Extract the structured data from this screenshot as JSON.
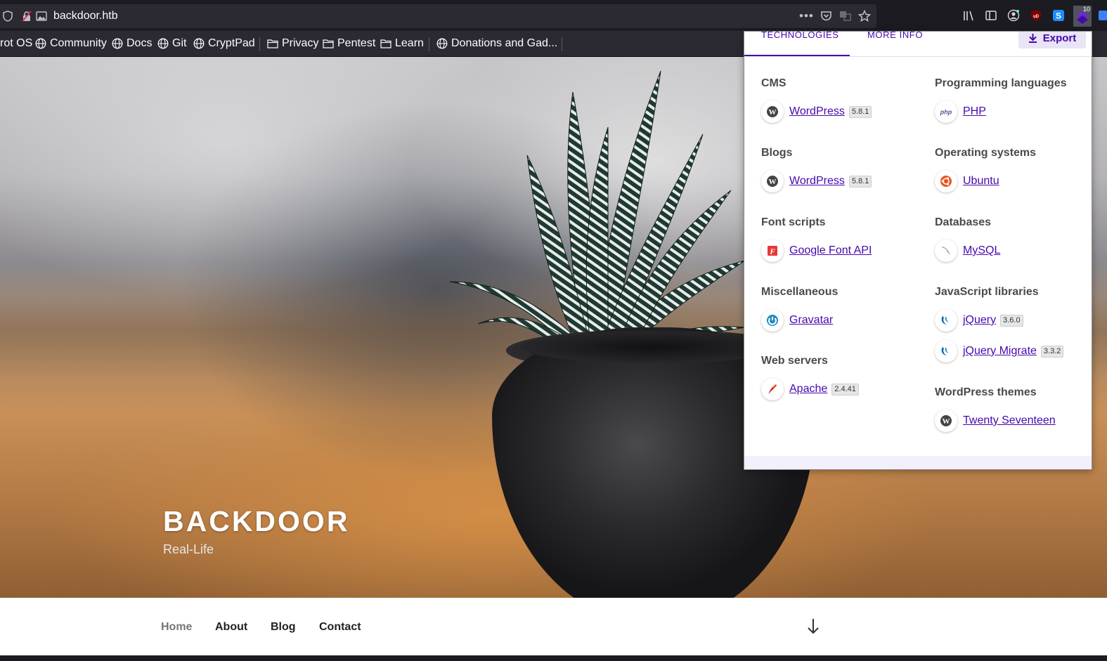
{
  "browser": {
    "url": "backdoor.htb",
    "bookmarks": [
      {
        "label": "rot OS",
        "icon": "globe-icon"
      },
      {
        "label": "Community",
        "icon": "globe-icon"
      },
      {
        "label": "Docs",
        "icon": "globe-icon"
      },
      {
        "label": "Git",
        "icon": "globe-icon"
      },
      {
        "label": "CryptPad",
        "icon": "globe-icon"
      },
      {
        "label": "Privacy",
        "icon": "folder-icon"
      },
      {
        "label": "Pentest",
        "icon": "folder-icon"
      },
      {
        "label": "Learn",
        "icon": "folder-icon"
      },
      {
        "label": "Donations and Gad...",
        "icon": "globe-icon"
      }
    ],
    "extension_badge": "10"
  },
  "site": {
    "title": "BACKDOOR",
    "description": "Real-Life",
    "nav": [
      {
        "label": "Home",
        "current": true
      },
      {
        "label": "About",
        "current": false
      },
      {
        "label": "Blog",
        "current": false
      },
      {
        "label": "Contact",
        "current": false
      }
    ]
  },
  "wappalyzer": {
    "tabs": {
      "technologies": "TECHNOLOGIES",
      "more_info": "MORE INFO"
    },
    "export_label": "Export",
    "accent_color": "#4608ad",
    "categories": {
      "cms": {
        "title": "CMS",
        "items": [
          {
            "name": "WordPress",
            "version": "5.8.1",
            "icon": "wordpress-icon"
          }
        ]
      },
      "blogs": {
        "title": "Blogs",
        "items": [
          {
            "name": "WordPress",
            "version": "5.8.1",
            "icon": "wordpress-icon"
          }
        ]
      },
      "font_scripts": {
        "title": "Font scripts",
        "items": [
          {
            "name": "Google Font API",
            "icon": "google-font-icon"
          }
        ]
      },
      "misc": {
        "title": "Miscellaneous",
        "items": [
          {
            "name": "Gravatar",
            "icon": "gravatar-icon"
          }
        ]
      },
      "web_servers": {
        "title": "Web servers",
        "items": [
          {
            "name": "Apache",
            "version": "2.4.41",
            "icon": "apache-icon"
          }
        ]
      },
      "prog_langs": {
        "title": "Programming languages",
        "items": [
          {
            "name": "PHP",
            "icon": "php-icon"
          }
        ]
      },
      "os": {
        "title": "Operating systems",
        "items": [
          {
            "name": "Ubuntu",
            "icon": "ubuntu-icon"
          }
        ]
      },
      "databases": {
        "title": "Databases",
        "items": [
          {
            "name": "MySQL",
            "icon": "mysql-icon"
          }
        ]
      },
      "js_libs": {
        "title": "JavaScript libraries",
        "items": [
          {
            "name": "jQuery",
            "version": "3.6.0",
            "icon": "jquery-icon"
          },
          {
            "name": "jQuery Migrate",
            "version": "3.3.2",
            "icon": "jquery-icon"
          }
        ]
      },
      "wp_themes": {
        "title": "WordPress themes",
        "items": [
          {
            "name": "Twenty Seventeen",
            "icon": "wordpress-icon"
          }
        ]
      }
    }
  }
}
